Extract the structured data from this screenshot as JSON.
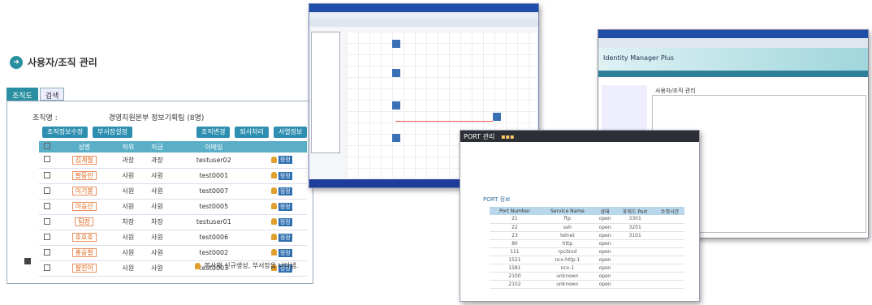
{
  "panel1": {
    "title": "사용자/조직 관리",
    "tabs": [
      "조직도",
      "검색"
    ],
    "org_label": "조직명 :",
    "org_name": "경영지원본부 정보기획팀 (8명)",
    "buttons_left": [
      "조직정보수정",
      "부서장설정"
    ],
    "buttons_right": [
      "조직변경",
      "퇴사처리",
      "서열정보"
    ],
    "columns": [
      "성명",
      "직위",
      "직급",
      "이메일"
    ],
    "rows": [
      {
        "name": "김계철",
        "pos": "과장",
        "grade": "과장",
        "email": "testuser02"
      },
      {
        "name": "팔동민",
        "pos": "사원",
        "grade": "사원",
        "email": "test0001"
      },
      {
        "name": "이기봉",
        "pos": "사원",
        "grade": "사원",
        "email": "test0007"
      },
      {
        "name": "이승산",
        "pos": "사원",
        "grade": "사원",
        "email": "test0005"
      },
      {
        "name": "팀장",
        "pos": "차장",
        "grade": "차장",
        "email": "testuser01"
      },
      {
        "name": "호호호",
        "pos": "사원",
        "grade": "사원",
        "email": "test0006"
      },
      {
        "name": "홍승철",
        "pos": "사원",
        "grade": "사원",
        "email": "test0002"
      },
      {
        "name": "팔진이",
        "pos": "사원",
        "grade": "사원",
        "email": "test0003"
      }
    ],
    "edit_label": "정정",
    "legend": "복사해 신규생성, 부서장을 나타냄."
  },
  "panel3": {
    "product": "Identity Manager Plus",
    "section": "사용자/조직 관리"
  },
  "panel4": {
    "title": "PORT 관리",
    "section": "PORT 정보",
    "columns": [
      "Port Number",
      "Service Name",
      "상태",
      "포워드 Port",
      "수정시간"
    ],
    "rows": [
      [
        "21",
        "ftp",
        "open",
        "3301",
        ""
      ],
      [
        "22",
        "ssh",
        "open",
        "3201",
        ""
      ],
      [
        "23",
        "telnet",
        "open",
        "3101",
        ""
      ],
      [
        "80",
        "http",
        "open",
        "",
        ""
      ],
      [
        "111",
        "rpcbind",
        "open",
        "",
        ""
      ],
      [
        "1521",
        "ncx-http-1",
        "open",
        "",
        ""
      ],
      [
        "1581",
        "ncx-1",
        "open",
        "",
        ""
      ],
      [
        "2100",
        "unknown",
        "open",
        "",
        ""
      ],
      [
        "2102",
        "unknown",
        "open",
        "",
        ""
      ]
    ]
  }
}
